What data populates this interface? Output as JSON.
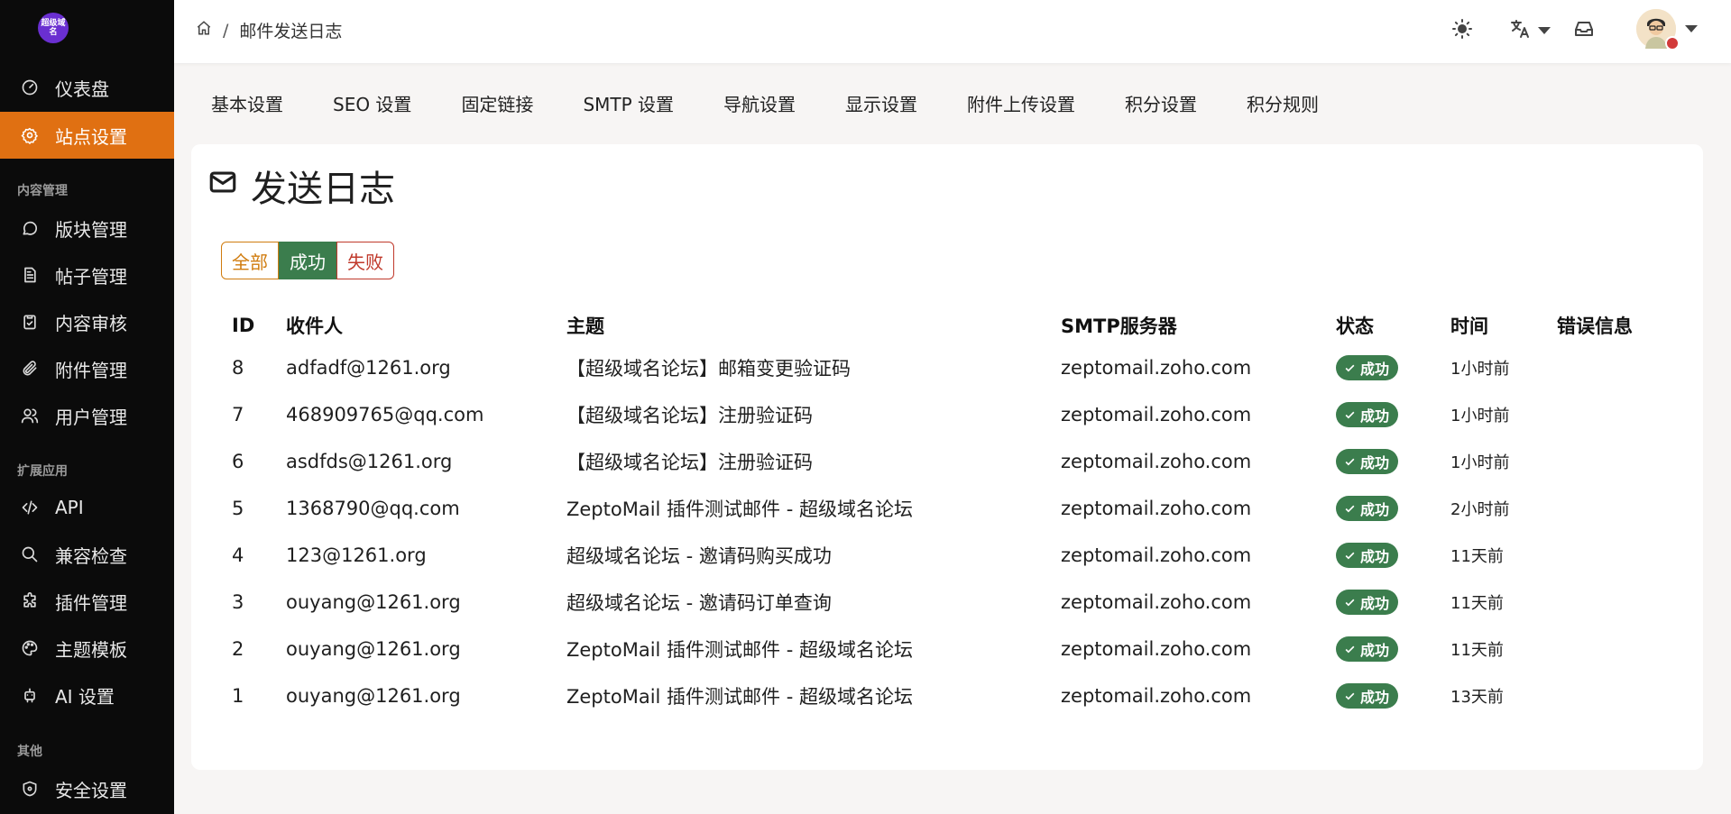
{
  "logo": {
    "text": "超级域名"
  },
  "sidebar": {
    "top_items": [
      {
        "label": "仪表盘",
        "icon": "dashboard-icon"
      },
      {
        "label": "站点设置",
        "icon": "gear-icon",
        "active": true
      }
    ],
    "sections": [
      {
        "title": "内容管理",
        "items": [
          {
            "label": "版块管理",
            "icon": "chat-bubble-icon"
          },
          {
            "label": "帖子管理",
            "icon": "document-icon"
          },
          {
            "label": "内容审核",
            "icon": "clipboard-check-icon"
          },
          {
            "label": "附件管理",
            "icon": "paperclip-icon"
          },
          {
            "label": "用户管理",
            "icon": "users-icon"
          }
        ]
      },
      {
        "title": "扩展应用",
        "items": [
          {
            "label": "API",
            "icon": "code-icon"
          },
          {
            "label": "兼容检查",
            "icon": "search-icon"
          },
          {
            "label": "插件管理",
            "icon": "puzzle-icon"
          },
          {
            "label": "主题模板",
            "icon": "palette-icon"
          },
          {
            "label": "AI 设置",
            "icon": "robot-icon"
          }
        ]
      },
      {
        "title": "其他",
        "items": [
          {
            "label": "安全设置",
            "icon": "shield-icon"
          }
        ]
      }
    ]
  },
  "header": {
    "breadcrumb": {
      "current": "邮件发送日志"
    }
  },
  "tabs": [
    "基本设置",
    "SEO 设置",
    "固定链接",
    "SMTP 设置",
    "导航设置",
    "显示设置",
    "附件上传设置",
    "积分设置",
    "积分规则"
  ],
  "card": {
    "title": "发送日志",
    "filters": {
      "all": "全部",
      "success": "成功",
      "failed": "失败"
    },
    "columns": {
      "id": "ID",
      "to": "收件人",
      "subject": "主题",
      "smtp": "SMTP服务器",
      "status": "状态",
      "time": "时间",
      "error": "错误信息"
    },
    "rows": [
      {
        "id": "8",
        "to": "adfadf@1261.org",
        "subject": "【超级域名论坛】邮箱变更验证码",
        "smtp": "zeptomail.zoho.com",
        "status": "成功",
        "time": "1小时前",
        "error": ""
      },
      {
        "id": "7",
        "to": "468909765@qq.com",
        "subject": "【超级域名论坛】注册验证码",
        "smtp": "zeptomail.zoho.com",
        "status": "成功",
        "time": "1小时前",
        "error": ""
      },
      {
        "id": "6",
        "to": "asdfds@1261.org",
        "subject": "【超级域名论坛】注册验证码",
        "smtp": "zeptomail.zoho.com",
        "status": "成功",
        "time": "1小时前",
        "error": ""
      },
      {
        "id": "5",
        "to": "1368790@qq.com",
        "subject": "ZeptoMail 插件测试邮件 - 超级域名论坛",
        "smtp": "zeptomail.zoho.com",
        "status": "成功",
        "time": "2小时前",
        "error": ""
      },
      {
        "id": "4",
        "to": "123@1261.org",
        "subject": "超级域名论坛 - 邀请码购买成功",
        "smtp": "zeptomail.zoho.com",
        "status": "成功",
        "time": "11天前",
        "error": ""
      },
      {
        "id": "3",
        "to": "ouyang@1261.org",
        "subject": "超级域名论坛 - 邀请码订单查询",
        "smtp": "zeptomail.zoho.com",
        "status": "成功",
        "time": "11天前",
        "error": ""
      },
      {
        "id": "2",
        "to": "ouyang@1261.org",
        "subject": "ZeptoMail 插件测试邮件 - 超级域名论坛",
        "smtp": "zeptomail.zoho.com",
        "status": "成功",
        "time": "11天前",
        "error": ""
      },
      {
        "id": "1",
        "to": "ouyang@1261.org",
        "subject": "ZeptoMail 插件测试邮件 - 超级域名论坛",
        "smtp": "zeptomail.zoho.com",
        "status": "成功",
        "time": "13天前",
        "error": ""
      }
    ]
  },
  "colors": {
    "accent": "#e07012",
    "success": "#3b7d4d",
    "danger": "#c0392b",
    "sidebar_bg": "#0b0b0b"
  }
}
